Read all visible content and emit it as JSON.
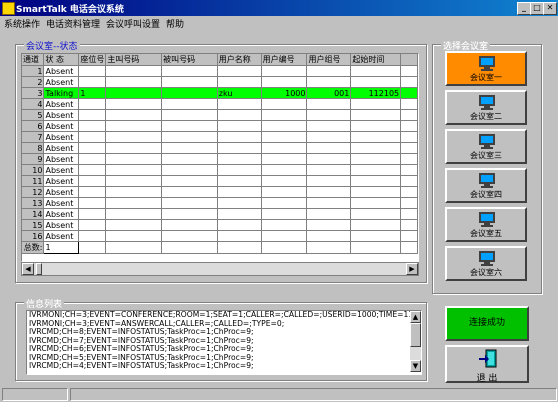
{
  "window": {
    "title": "SmartTalk 电话会议系统",
    "min": "_",
    "max": "□",
    "close": "✕"
  },
  "menu": [
    "系统操作",
    "电话资料管理",
    "会议呼叫设置",
    "帮助"
  ],
  "room_panel": {
    "legend": "会议室--状态",
    "columns": [
      "通道",
      "状 态",
      "座位号",
      "主叫号码",
      "被叫号码",
      "用户名称",
      "用户编号",
      "用户组号",
      "起始时间"
    ],
    "rows": [
      [
        "1",
        "Absent",
        "",
        "",
        "",
        "",
        "",
        "",
        ""
      ],
      [
        "2",
        "Absent",
        "",
        "",
        "",
        "",
        "",
        "",
        ""
      ],
      [
        "3",
        "Talking",
        "1",
        "",
        "",
        "zku",
        "1000",
        "001",
        "112105"
      ],
      [
        "4",
        "Absent",
        "",
        "",
        "",
        "",
        "",
        "",
        ""
      ],
      [
        "5",
        "Absent",
        "",
        "",
        "",
        "",
        "",
        "",
        ""
      ],
      [
        "6",
        "Absent",
        "",
        "",
        "",
        "",
        "",
        "",
        ""
      ],
      [
        "7",
        "Absent",
        "",
        "",
        "",
        "",
        "",
        "",
        ""
      ],
      [
        "8",
        "Absent",
        "",
        "",
        "",
        "",
        "",
        "",
        ""
      ],
      [
        "9",
        "Absent",
        "",
        "",
        "",
        "",
        "",
        "",
        ""
      ],
      [
        "10",
        "Absent",
        "",
        "",
        "",
        "",
        "",
        "",
        ""
      ],
      [
        "11",
        "Absent",
        "",
        "",
        "",
        "",
        "",
        "",
        ""
      ],
      [
        "12",
        "Absent",
        "",
        "",
        "",
        "",
        "",
        "",
        ""
      ],
      [
        "13",
        "Absent",
        "",
        "",
        "",
        "",
        "",
        "",
        ""
      ],
      [
        "14",
        "Absent",
        "",
        "",
        "",
        "",
        "",
        "",
        ""
      ],
      [
        "15",
        "Absent",
        "",
        "",
        "",
        "",
        "",
        "",
        ""
      ],
      [
        "16",
        "Absent",
        "",
        "",
        "",
        "",
        "",
        "",
        ""
      ]
    ],
    "total_label": "总数:",
    "total_value": "1"
  },
  "room_select": {
    "legend": "选择会议室",
    "rooms": [
      "会议室一",
      "会议室二",
      "会议室三",
      "会议室四",
      "会议室五",
      "会议室六"
    ],
    "active_index": 0
  },
  "log_panel": {
    "legend": "信息列表",
    "lines": [
      "IVRMONI;CH=3;EVENT=CONFERENCE;ROOM=1;SEAT=1;CALLER=;CALLED=;USERID=1000;TIME=112105;TY",
      "IVRMONI;CH=3;EVENT=ANSWERCALL;CALLER=;CALLED=;TYPE=0;",
      "IVRCMD;CH=8;EVENT=INFOSTATUS;TaskProc=1;ChProc=9;",
      "IVRCMD;CH=7;EVENT=INFOSTATUS;TaskProc=1;ChProc=9;",
      "IVRCMD;CH=6;EVENT=INFOSTATUS;TaskProc=1;ChProc=9;",
      "IVRCMD;CH=5;EVENT=INFOSTATUS;TaskProc=1;ChProc=9;",
      "IVRCMD;CH=4;EVENT=INFOSTATUS;TaskProc=1;ChProc=9;"
    ]
  },
  "connect_button": {
    "label": "连接成功",
    "color": "#00c000"
  },
  "exit_button": {
    "label": "退 出"
  },
  "colors": {
    "talking_row": "#00ff00",
    "active_room": "#ff8c00",
    "title_bar": "#000080"
  }
}
